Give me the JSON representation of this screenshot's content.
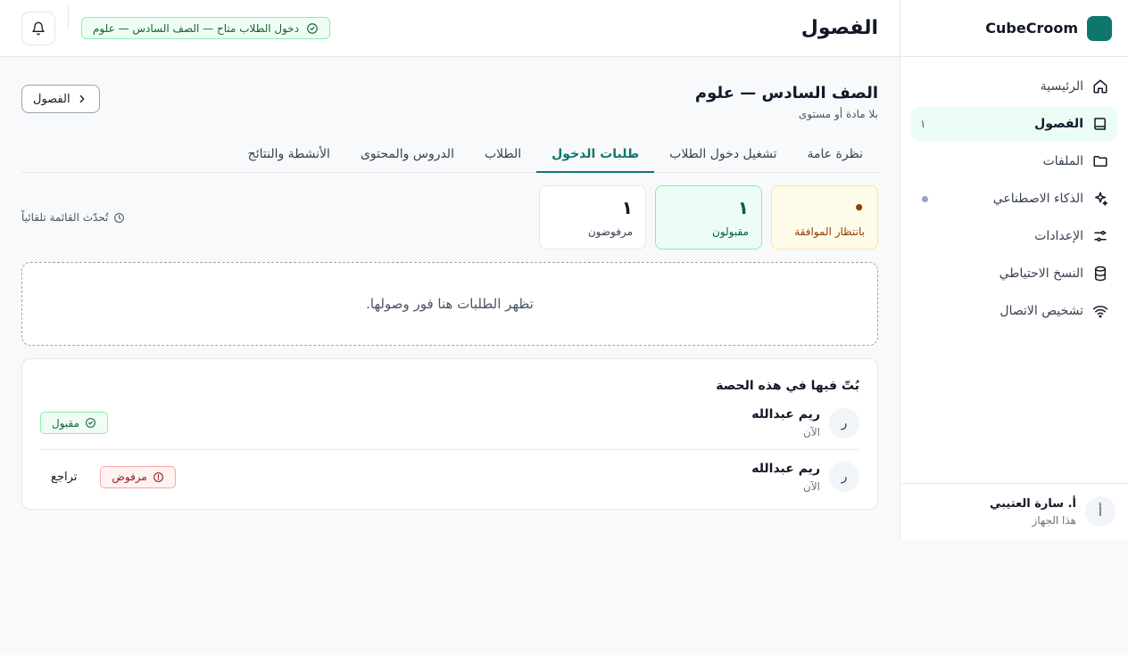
{
  "app": {
    "name": "CubeCroom"
  },
  "sidebar": {
    "items": [
      {
        "label": "الرئيسية",
        "icon": "home-icon"
      },
      {
        "label": "الفصول",
        "icon": "book-icon",
        "badge": "١"
      },
      {
        "label": "الملفات",
        "icon": "folder-icon"
      },
      {
        "label": "الذكاء الاصطناعي",
        "icon": "sparkles-icon"
      },
      {
        "label": "الإعدادات",
        "icon": "sliders-icon"
      },
      {
        "label": "النسخ الاحتياطي",
        "icon": "database-icon"
      },
      {
        "label": "تشخيص الاتصال",
        "icon": "wifi-icon"
      }
    ],
    "user": {
      "initial": "أ",
      "name": "أ. سارة العتيبي",
      "sub": "هذا الجهاز"
    }
  },
  "header": {
    "title": "الفصول",
    "live_status": "دخول الطلاب متاح — الصف السادس — علوم"
  },
  "class": {
    "back_label": "الفصول",
    "title": "الصف السادس — علوم",
    "subtitle": "بلا مادة أو مستوى"
  },
  "tabs": [
    {
      "label": "نظرة عامة"
    },
    {
      "label": "تشغيل دخول الطلاب"
    },
    {
      "label": "طلبات الدخول",
      "active": true
    },
    {
      "label": "الطلاب"
    },
    {
      "label": "الدروس والمحتوى"
    },
    {
      "label": "الأنشطة والنتائج"
    }
  ],
  "stats": {
    "pending": {
      "value": "•",
      "label": "بانتظار الموافقة"
    },
    "accepted": {
      "value": "١",
      "label": "مقبولون"
    },
    "rejected": {
      "value": "١",
      "label": "مرفوضون"
    }
  },
  "auto_refresh": "تُحدّث القائمة تلقائياً",
  "empty_message": "تظهر الطلبات هنا فور وصولها.",
  "decided": {
    "title": "بُتّ فيها في هذه الحصة",
    "rows": [
      {
        "initial": "ر",
        "name": "ريم عبدالله",
        "time": "الآن",
        "status": "مقبول",
        "undo": ""
      },
      {
        "initial": "ر",
        "name": "ريم عبدالله",
        "time": "الآن",
        "status": "مرفوض",
        "undo": "تراجع"
      }
    ]
  },
  "colors": {
    "accent": "#0f766e",
    "accepted": "#166534",
    "rejected": "#991b1b",
    "pending": "#92400e"
  }
}
